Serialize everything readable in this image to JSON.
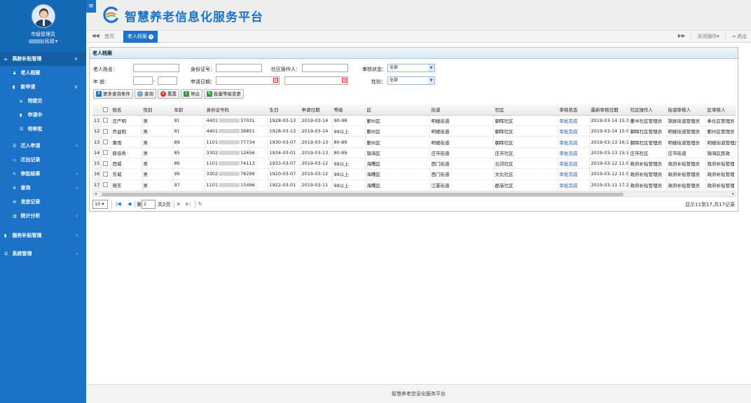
{
  "header": {
    "title": "智慧养老信息化服务平台"
  },
  "user": {
    "name": "市级管理员",
    "dept": "民政"
  },
  "sidebar": {
    "items": [
      {
        "label": "高龄补贴管理",
        "arrow": "∨"
      },
      {
        "label": "老人档案"
      },
      {
        "label": "新申请",
        "arrow": "∨"
      },
      {
        "label": "待提交"
      },
      {
        "label": "申请中"
      },
      {
        "label": "待审批"
      },
      {
        "label": "迁入申请",
        "arrow": "‹"
      },
      {
        "label": "迁出记录"
      },
      {
        "label": "审批结果",
        "arrow": "‹"
      },
      {
        "label": "查询",
        "arrow": "‹"
      },
      {
        "label": "发放记录"
      },
      {
        "label": "统计分析",
        "arrow": "‹"
      },
      {
        "label": "服务补贴管理",
        "arrow": "‹"
      },
      {
        "label": "系统管理",
        "arrow": "‹"
      }
    ]
  },
  "tabs": {
    "home": "首页",
    "active": "老人档案",
    "close_ops": "关闭操作",
    "logout": "退出"
  },
  "panel": {
    "title": "老人档案"
  },
  "form": {
    "name_label": "老人姓名：",
    "id_label": "身份证号：",
    "operator_label": "社区操作人：",
    "status_label": "审核状态：",
    "status_value": "全部",
    "age_label": "年 龄：",
    "age_sep": "-",
    "apply_date_label": "申请日期：",
    "gender_label": "性别：",
    "gender_value": "全部"
  },
  "toolbar": {
    "more": "更多查询条件",
    "query": "查询",
    "reset": "重置",
    "export": "导出",
    "batch": "批量等级变更"
  },
  "table": {
    "columns": [
      "",
      "姓名",
      "性别",
      "年龄",
      "身份证号码",
      "生日",
      "申请日期",
      "等级",
      "区",
      "街道",
      "社区",
      "审核状态",
      "最新审核日期",
      "社区操作人",
      "街道审核人",
      "区审核人"
    ],
    "rows": [
      {
        "n": "11",
        "name": "庄严明",
        "gender": "男",
        "age": "91",
        "id_pre": "4401",
        "id_suf": "37031",
        "birth": "1928-03-13",
        "apply": "2019-03-14",
        "level": "90-98",
        "district": "鄞州区",
        "street": "明楼街道",
        "community": "朝晖社区",
        "status": "审批完成",
        "latest": "2019-03-14 15:3",
        "op": "董中社区管理员",
        "street_rev": "锦屏街道管理员",
        "dist_rev": "奉化区管理员"
      },
      {
        "n": "12",
        "name": "乔益阳",
        "gender": "男",
        "age": "91",
        "id_pre": "4401",
        "id_suf": "38851",
        "birth": "1928-03-13",
        "apply": "2019-03-14",
        "level": "99以上",
        "district": "鄞州区",
        "street": "明楼街道",
        "community": "朝晖社区",
        "status": "审批完成",
        "latest": "2019-03-14 15:0",
        "op": "朝晖社区管理员",
        "street_rev": "明楼街道管理员",
        "dist_rev": "鄞州区管理员"
      },
      {
        "n": "13",
        "name": "黄雨",
        "gender": "男",
        "age": "89",
        "id_pre": "1101",
        "id_suf": "77734",
        "birth": "1930-03-07",
        "apply": "2019-03-13",
        "level": "80-89",
        "district": "鄞州区",
        "street": "明楼街道",
        "community": "朝晖社区",
        "status": "审批完成",
        "latest": "2019-03-13 16:1",
        "op": "朝晖社区管理员",
        "street_rev": "明楼街道管理员",
        "dist_rev": "明楼街道管理员"
      },
      {
        "n": "14",
        "name": "薛佳秀",
        "gender": "男",
        "age": "85",
        "id_pre": "3302",
        "id_suf": "12656",
        "birth": "1934-03-01",
        "apply": "2019-03-13",
        "level": "80-89",
        "district": "镇海区",
        "street": "庄市街道",
        "community": "庄市社区",
        "status": "审批完成",
        "latest": "2019-03-13 15:1",
        "op": "庄市社区",
        "street_rev": "庄市街道",
        "dist_rev": "镇海区民政"
      },
      {
        "n": "15",
        "name": "西城",
        "gender": "男",
        "age": "86",
        "id_pre": "1101",
        "id_suf": "74113",
        "birth": "1933-03-07",
        "apply": "2019-03-12",
        "level": "99以上",
        "district": "海曙区",
        "street": "西门街道",
        "community": "北郊社区",
        "status": "审批完成",
        "latest": "2019-03-12 11:0",
        "op": "政府补贴管理员",
        "street_rev": "政府补贴管理员",
        "dist_rev": "政府补贴管理"
      },
      {
        "n": "16",
        "name": "东城",
        "gender": "男",
        "age": "99",
        "id_pre": "3302",
        "id_suf": "78299",
        "birth": "1920-03-07",
        "apply": "2019-03-12",
        "level": "99以上",
        "district": "海曙区",
        "street": "西门街道",
        "community": "文化社区",
        "status": "审批完成",
        "latest": "2019-03-12 11:0",
        "op": "政府补贴管理员",
        "street_rev": "政府补贴管理员",
        "dist_rev": "政府补贴管理"
      },
      {
        "n": "17",
        "name": "晓东",
        "gender": "男",
        "age": "97",
        "id_pre": "1101",
        "id_suf": "15496",
        "birth": "1922-03-01",
        "apply": "2019-03-11",
        "level": "99以上",
        "district": "海曙区",
        "street": "江厦街道",
        "community": "郡庙社区",
        "status": "审批完成",
        "latest": "2019-03-11 17:2",
        "op": "政府补贴管理员",
        "street_rev": "政府补贴管理员",
        "dist_rev": "政府补贴管理"
      }
    ]
  },
  "pager": {
    "size": "10",
    "page_label": "第",
    "page": "2",
    "total_pages": "共2页",
    "info": "显示11到17,共17记录"
  },
  "footer": {
    "text": "智慧养老信息化服务平台"
  },
  "colors": {
    "primary": "#1a73c6",
    "link": "#1f5bcb"
  }
}
